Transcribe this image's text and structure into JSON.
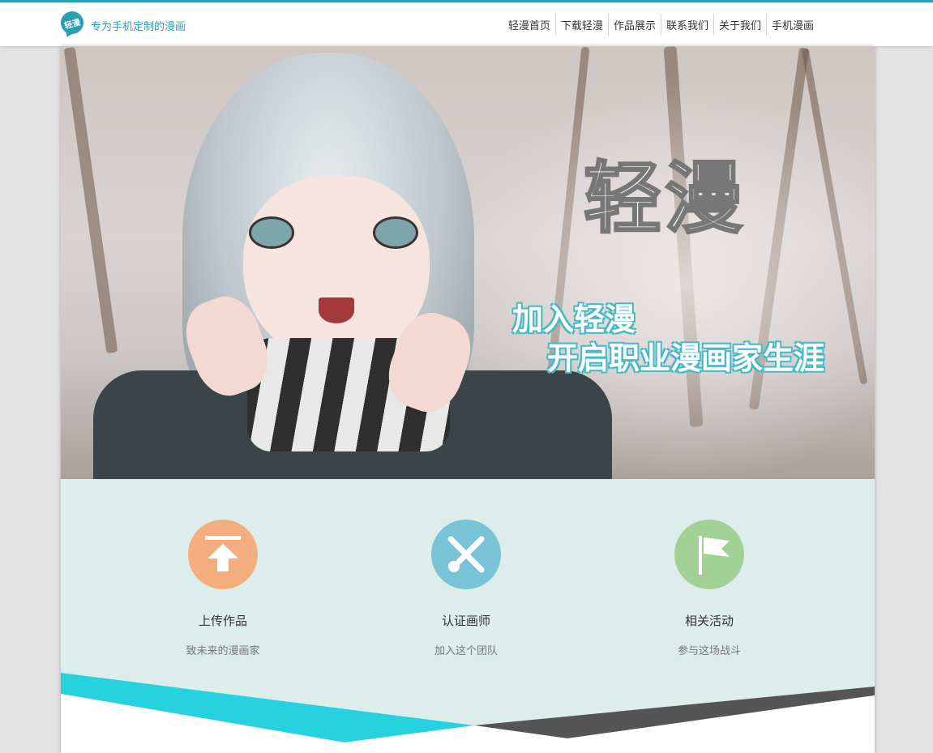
{
  "header": {
    "logo_text": "轻漫",
    "slogan": "专为手机定制的漫画",
    "nav": [
      "轻漫首页",
      "下载轻漫",
      "作品展示",
      "联系我们",
      "关于我们",
      "手机漫画"
    ]
  },
  "banner": {
    "title": "轻漫",
    "line1": "加入轻漫",
    "line2": "开启职业漫画家生涯"
  },
  "features": [
    {
      "title": "上传作品",
      "subtitle": "致未来的漫画家",
      "icon": "upload-icon",
      "color": "#f4ae7e"
    },
    {
      "title": "认证画师",
      "subtitle": "加入这个团队",
      "icon": "brush-pen-icon",
      "color": "#79c3d6"
    },
    {
      "title": "相关活动",
      "subtitle": "参与这场战斗",
      "icon": "flag-icon",
      "color": "#a3d195"
    }
  ],
  "colors": {
    "accent": "#2aa3b2",
    "cyan_band": "#25d2de",
    "dark_band": "#555555"
  }
}
